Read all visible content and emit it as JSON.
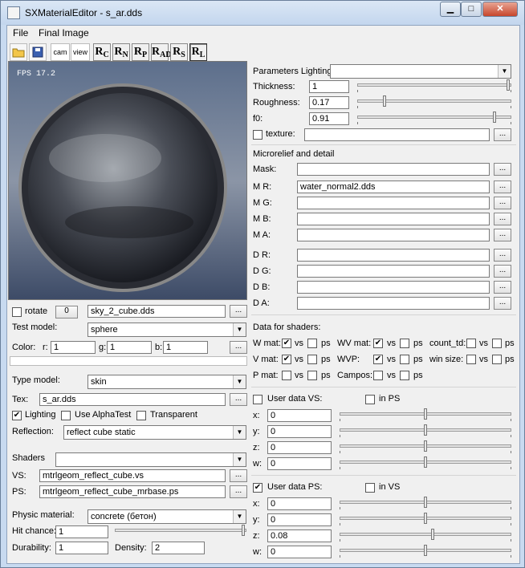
{
  "window": {
    "title": "SXMaterialEditor - s_ar.dds",
    "min": "▁",
    "max": "□",
    "close": "✕"
  },
  "menu": {
    "file": "File",
    "final_image": "Final Image"
  },
  "toolbar": {
    "cam": "cam",
    "view": "view",
    "rc": "R",
    "rc_sub": "C",
    "rn": "R",
    "rn_sub": "N",
    "rp": "R",
    "rp_sub": "P",
    "rad": "R",
    "rad_sub": "AD",
    "rs": "R",
    "rs_sub": "S",
    "rl": "R",
    "rl_sub": "L"
  },
  "viewport": {
    "fps": "FPS 17.2"
  },
  "left": {
    "rotate_label": "rotate",
    "rotate_value": "0",
    "skybox": "sky_2_cube.dds",
    "browse": "...",
    "test_model_label": "Test model:",
    "test_model": "sphere",
    "color_label": "Color:",
    "r_label": "r:",
    "r": "1",
    "g_label": "g:",
    "g": "1",
    "b_label": "b:",
    "b": "1",
    "type_model_label": "Type model:",
    "type_model": "skin",
    "tex_label": "Tex:",
    "tex": "s_ar.dds",
    "lighting_label": "Lighting",
    "alphatest_label": "Use AlphaTest",
    "transparent_label": "Transparent",
    "reflection_label": "Reflection:",
    "reflection": "reflect cube static",
    "shaders_label": "Shaders",
    "shaders": "",
    "vs_label": "VS:",
    "vs": "mtrlgeom_reflect_cube.vs",
    "ps_label": "PS:",
    "ps": "mtrlgeom_reflect_cube_mrbase.ps",
    "physic_label": "Physic material:",
    "physic": "concrete (бетон)",
    "hit_label": "Hit chance:",
    "hit": "1",
    "durability_label": "Durability:",
    "durability": "1",
    "density_label": "Density:",
    "density": "2"
  },
  "right": {
    "params_lighting_label": "Parameters Lighting:",
    "params_lighting": "",
    "thickness_label": "Thickness:",
    "thickness": "1",
    "thickness_level": 1.0,
    "roughness_label": "Roughness:",
    "roughness": "0.17",
    "roughness_level": 0.17,
    "f0_label": "f0:",
    "f0": "0.91",
    "f0_level": 0.91,
    "texture_label": "texture:",
    "texture": "",
    "micro_header": "Microrelief and detail",
    "mask_label": "Mask:",
    "mask": "",
    "mr_label": "M R:",
    "mr": "water_normal2.dds",
    "mg_label": "M G:",
    "mb_label": "M B:",
    "ma_label": "M A:",
    "dr_label": "D R:",
    "dg_label": "D G:",
    "db_label": "D B:",
    "da_label": "D A:",
    "data_header": "Data for shaders:",
    "wmat": "W mat:",
    "vmat": "V mat:",
    "pmat": "P mat:",
    "wvmat": "WV mat:",
    "wvp": "WVP:",
    "campos": "Campos:",
    "count_td": "count_td:",
    "win_size": "win size:",
    "vs": "vs",
    "ps": "ps",
    "userdata_vs_label": "User data VS:",
    "in_ps_label": "in PS",
    "userdata_ps_label": "User data PS:",
    "in_vs_label": "in VS",
    "x_label": "x:",
    "y_label": "y:",
    "z_label": "z:",
    "w_label": "w:",
    "vs_x": "0",
    "vs_y": "0",
    "vs_z": "0",
    "vs_w": "0",
    "ps_x": "0",
    "ps_y": "0",
    "ps_z": "0.08",
    "ps_w": "0"
  }
}
